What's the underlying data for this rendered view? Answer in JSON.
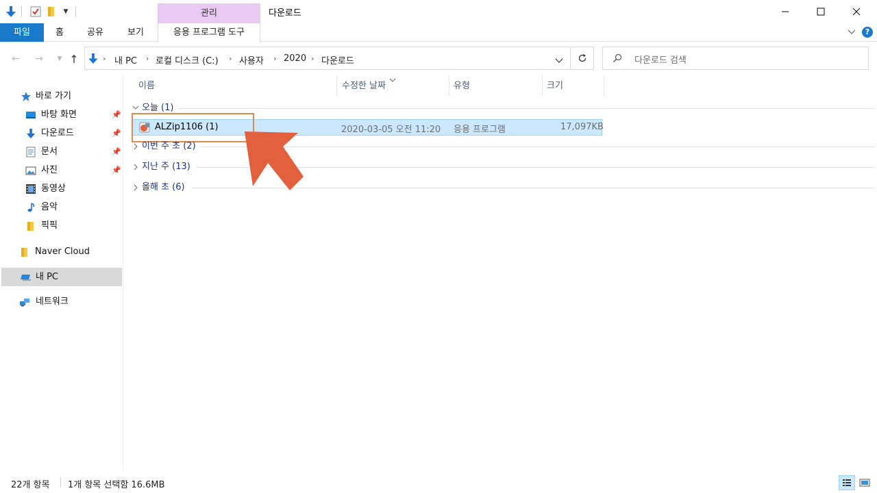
{
  "window": {
    "title": "다운로드",
    "manage_tab": "관리"
  },
  "ribbon": {
    "tabs": [
      "파일",
      "홈",
      "공유",
      "보기",
      "응용 프로그램 도구"
    ]
  },
  "address": {
    "crumbs": [
      "내 PC",
      "로컬 디스크 (C:)",
      "사용자",
      "2020",
      "다운로드"
    ],
    "search_placeholder": "다운로드 검색"
  },
  "sidebar": {
    "quick_access": "바로 가기",
    "items": [
      {
        "label": "바탕 화면",
        "pinned": true
      },
      {
        "label": "다운로드",
        "pinned": true
      },
      {
        "label": "문서",
        "pinned": true
      },
      {
        "label": "사진",
        "pinned": true
      },
      {
        "label": "동영상",
        "pinned": false
      },
      {
        "label": "음악",
        "pinned": false
      },
      {
        "label": "픽픽",
        "pinned": false
      }
    ],
    "naver_cloud": "Naver Cloud",
    "this_pc": "내 PC",
    "network": "네트워크"
  },
  "columns": {
    "name": "이름",
    "date": "수정한 날짜",
    "type": "유형",
    "size": "크기"
  },
  "groups": {
    "today": "오늘 (1)",
    "this_week": "이번 주 초 (2)",
    "last_week": "지난 주 (13)",
    "this_year": "올해 초 (6)"
  },
  "file": {
    "name": "ALZip1106 (1)",
    "date": "2020-03-05 오전 11:20",
    "type": "응용 프로그램",
    "size": "17,097KB"
  },
  "status": {
    "count": "22개 항목",
    "selected": "1개 항목 선택함 16.6MB"
  },
  "colors": {
    "file_tab": "#1979ca",
    "manage_tab": "#e9c8f4",
    "selection": "#cce8ff",
    "arrow": "#e2603c",
    "highlight": "#e08a4a"
  }
}
